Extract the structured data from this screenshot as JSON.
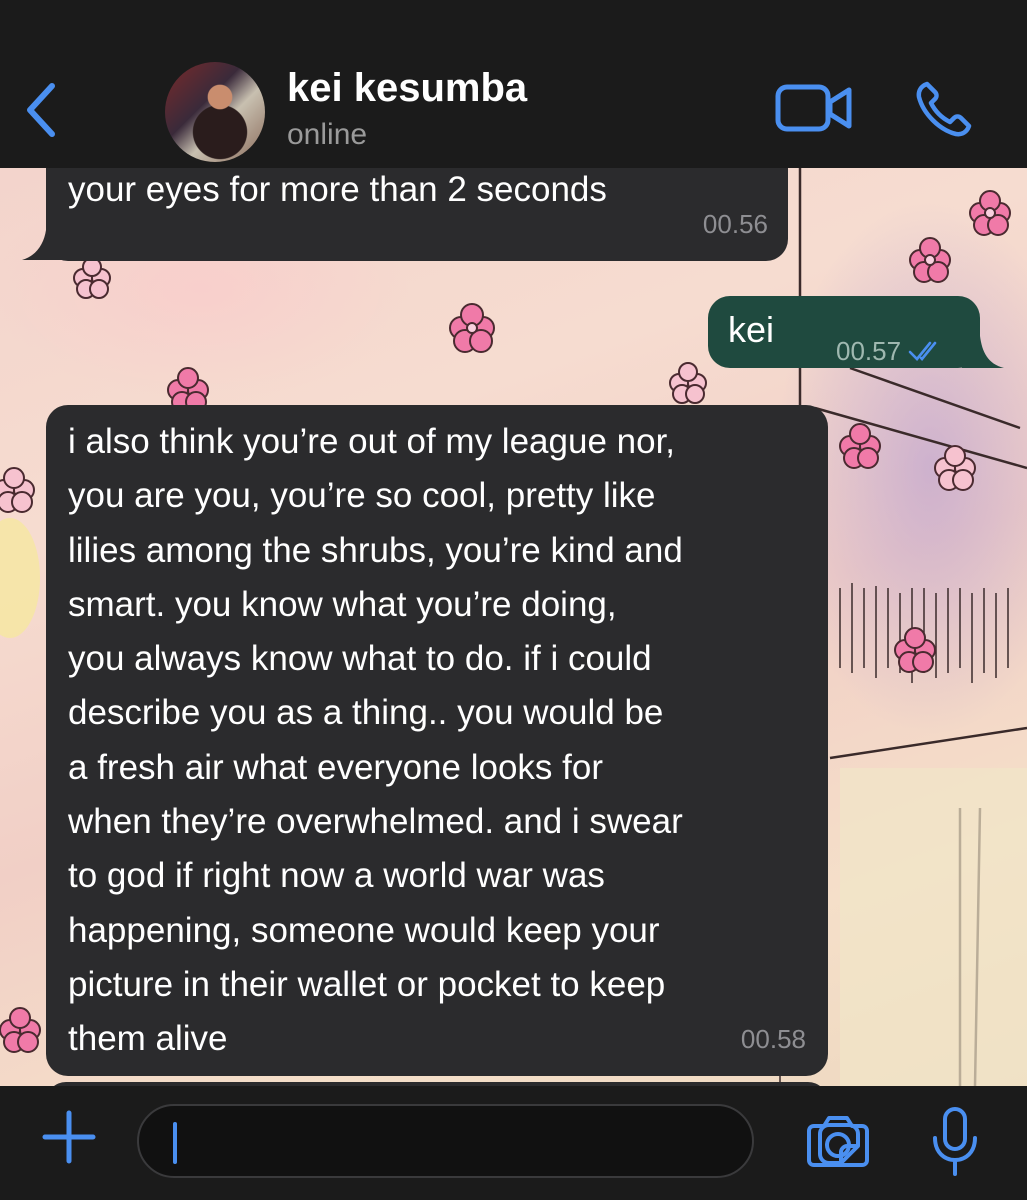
{
  "header": {
    "back_icon": "chevron-left-icon",
    "contact_name": "kei kesumba",
    "status": "online",
    "video_icon": "video-camera-icon",
    "phone_icon": "phone-icon",
    "accent_color": "#4a8ff0"
  },
  "messages": [
    {
      "direction": "incoming",
      "text": "your eyes for more than 2 seconds",
      "time": "00.56"
    },
    {
      "direction": "outgoing",
      "text": "kei",
      "time": "00.57",
      "read_icon": "double-check-icon"
    },
    {
      "direction": "incoming",
      "text": "i also think you’re out of my league nor,\nyou are you, you’re so cool, pretty like\nlilies among the shrubs, you’re kind and\nsmart. you know what you’re doing,\nyou always know what to do. if i could\ndescribe you as a thing.. you would be\na fresh air what everyone looks for\nwhen they’re overwhelmed. and i swear\nto god if right now a world war was\nhappening, someone would keep your\npicture in their wallet or pocket to keep\nthem alive",
      "time": "00.58"
    }
  ],
  "composer": {
    "plus_icon": "plus-icon",
    "input_value": "",
    "sticker_icon": "sticker-icon",
    "camera_icon": "camera-icon",
    "mic_icon": "microphone-icon"
  },
  "colors": {
    "incoming_bubble": "#2b2b2d",
    "outgoing_bubble": "#1f4a3f",
    "bar_background": "#1b1b1b"
  }
}
